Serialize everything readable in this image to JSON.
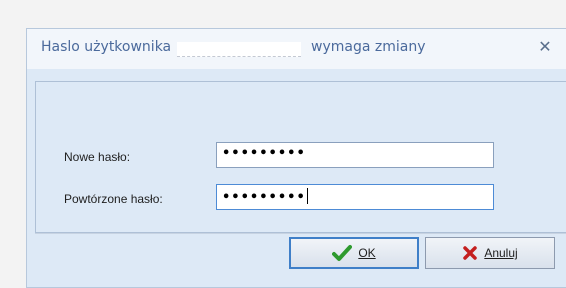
{
  "dialog": {
    "title_before": "Haslo użytkownika",
    "title_after": "wymaga zmiany",
    "close_icon": "close-icon"
  },
  "form": {
    "new_password_label": "Nowe hasło:",
    "new_password_value": "•••••••••",
    "repeat_password_label": "Powtórzone hasło:",
    "repeat_password_value": "•••••••••"
  },
  "buttons": {
    "ok_label": "OK",
    "ok_icon": "checkmark-icon",
    "ok_color": "#2e9a2e",
    "cancel_label": "Anuluj",
    "cancel_icon": "x-icon",
    "cancel_color": "#c41f1f"
  }
}
